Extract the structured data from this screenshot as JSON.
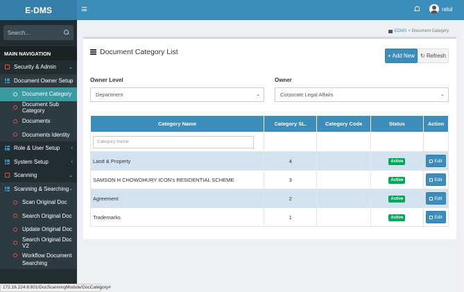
{
  "app": {
    "brand": "E-DMS"
  },
  "sidebar": {
    "search_placeholder": "Search...",
    "nav_header": "MAIN NAVIGATION",
    "items": [
      {
        "label": "Security & Admin",
        "type": "parent",
        "icon": "laptop-icon",
        "caret": "⌄"
      },
      {
        "label": "Document Owner Setup",
        "type": "parent",
        "icon": "grid-icon",
        "caret": "⌄"
      },
      {
        "label": "Document Category",
        "type": "sub",
        "active": true
      },
      {
        "label": "Document Sub Category",
        "type": "sub"
      },
      {
        "label": "Documents",
        "type": "sub"
      },
      {
        "label": "Documents Identity",
        "type": "sub"
      },
      {
        "label": "Role & User Setup",
        "type": "parent",
        "icon": "grid-icon",
        "caret": "‹"
      },
      {
        "label": "System Setup",
        "type": "parent",
        "icon": "grid-icon",
        "caret": "‹"
      },
      {
        "label": "Scanning",
        "type": "parent",
        "icon": "laptop-icon",
        "caret": "⌄"
      },
      {
        "label": "Scanning & Searching",
        "type": "parent",
        "icon": "grid-icon",
        "caret": "⌄"
      },
      {
        "label": "Scan Original Doc",
        "type": "sub"
      },
      {
        "label": "Search Original Doc",
        "type": "sub"
      },
      {
        "label": "Update Original Doc",
        "type": "sub"
      },
      {
        "label": "Search Original Doc V2",
        "type": "sub"
      },
      {
        "label": "Workflow Document Searching",
        "type": "sub"
      }
    ]
  },
  "topbar": {
    "username": "ratul"
  },
  "breadcrumb": {
    "home": "EDMS",
    "separator": ">",
    "current": "Document Category"
  },
  "box": {
    "title": "Document Category List",
    "add_label": "+ Add New",
    "refresh_label": "↻ Refresh"
  },
  "filters": {
    "owner_level_label": "Owner Level",
    "owner_level_value": "Department",
    "owner_label": "Owner",
    "owner_value": "Corporate Legal Affairs"
  },
  "table": {
    "headers": [
      "Category Name",
      "Category SL.",
      "Category Code",
      "Status",
      "Action"
    ],
    "filter_placeholder": "Category Name",
    "rows": [
      {
        "name": "Land & Property",
        "sl": "4",
        "code": "",
        "status": "Active",
        "action": "Edit"
      },
      {
        "name": "SAMSON H CHOWDHURY ICON's RESIDENTIAL SCHEME",
        "sl": "3",
        "code": "",
        "status": "Active",
        "action": "Edit"
      },
      {
        "name": "Agreement",
        "sl": "2",
        "code": "",
        "status": "Active",
        "action": "Edit"
      },
      {
        "name": "Trademarks",
        "sl": "1",
        "code": "",
        "status": "Active",
        "action": "Edit"
      }
    ]
  },
  "statusbar": {
    "url": "172.16.224.8:801/DocScanningModule/DocCategory#"
  },
  "colors": {
    "primary": "#3c8dbc",
    "sidebar": "#222d32",
    "active": "#3c9aa3",
    "success": "#00a65a"
  }
}
